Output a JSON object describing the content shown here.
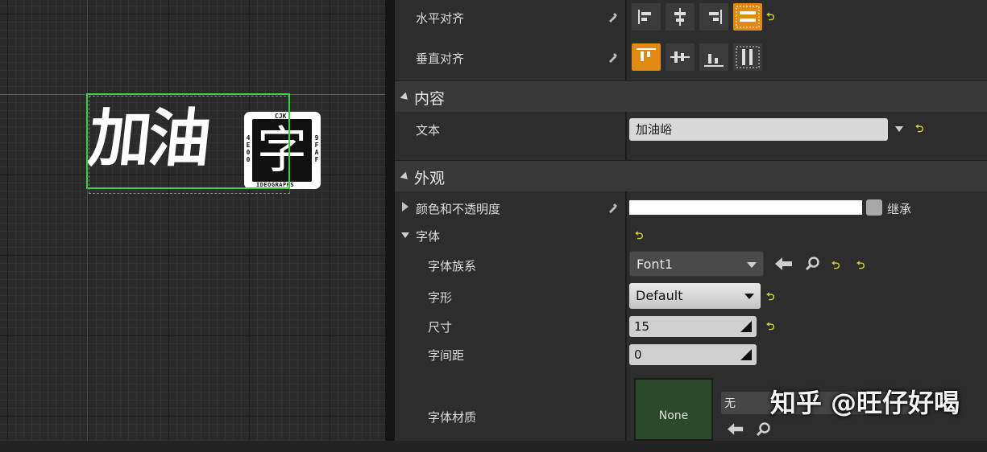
{
  "viewport": {
    "display_text": "加油",
    "badge": {
      "glyph": "字",
      "top": "CJK",
      "bottom": "IDEOGRAPHS",
      "left": "4E00",
      "right": "9FAF"
    }
  },
  "details": {
    "h_align": {
      "label": "水平对齐",
      "options": [
        "left",
        "center",
        "right",
        "fill"
      ],
      "selected": "fill"
    },
    "v_align": {
      "label": "垂直对齐",
      "options": [
        "top",
        "center",
        "bottom",
        "fill"
      ],
      "selected": "top"
    },
    "content": {
      "title": "内容",
      "text_label": "文本",
      "text_value": "加油峪"
    },
    "appearance": {
      "title": "外观",
      "color_label": "颜色和不透明度",
      "color_value": "#ffffff",
      "inherit_label": "继承",
      "font_label": "字体",
      "font_family_label": "字体族系",
      "font_family_value": "Font1",
      "typeface_label": "字形",
      "typeface_value": "Default",
      "size_label": "尺寸",
      "size_value": "15",
      "spacing_label": "字间距",
      "spacing_value": "0",
      "material_label": "字体材质",
      "material_value": "None",
      "material_none_short": "无"
    }
  },
  "watermark": "知乎 @旺仔好喝",
  "colors": {
    "accent": "#e08a14",
    "selection": "#35d43a",
    "reset_arrow": "#d4d42a"
  }
}
